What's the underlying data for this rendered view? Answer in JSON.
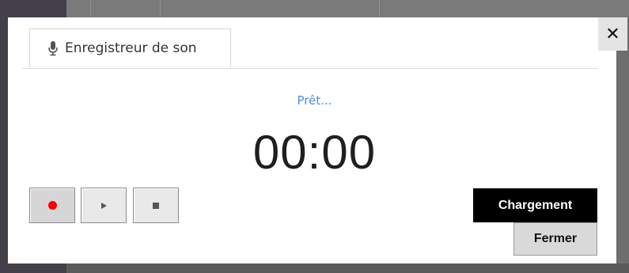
{
  "dialog": {
    "tab_label": "Enregistreur de son",
    "tab_icon": "microphone-icon",
    "close_icon": "close-icon",
    "close_glyph": "✕"
  },
  "recorder": {
    "status": "Prêt...",
    "time": "00:00",
    "record_icon": "record-icon",
    "play_icon": "play-icon",
    "stop_icon": "stop-icon"
  },
  "actions": {
    "upload_label": "Chargement",
    "close_label": "Fermer"
  },
  "colors": {
    "status_text": "#4f8fd6",
    "record_dot": "#ff0000",
    "primary_button_bg": "#000000"
  }
}
